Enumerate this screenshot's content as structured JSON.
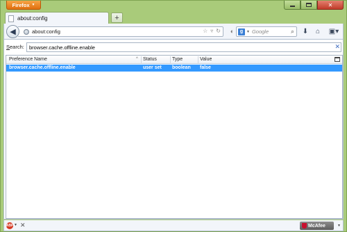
{
  "window": {
    "app_button_label": "Firefox",
    "app_button_caret": "▼",
    "accent_color": "#e0700f",
    "frame_color": "#a9cb7a"
  },
  "tabs": [
    {
      "label": "about:config",
      "icon": "page-icon"
    }
  ],
  "new_tab_label": "+",
  "navbar": {
    "back_icon": "back-arrow-icon",
    "url": "about:config",
    "search_placeholder": "Google",
    "search_engine_letter": "g"
  },
  "filter": {
    "label_pre": "",
    "label_underlined": "S",
    "label_post": "earch:",
    "value": "browser.cache.offline.enable",
    "clear_glyph": "✕"
  },
  "table": {
    "columns": [
      "Preference Name",
      "Status",
      "Type",
      "Value"
    ],
    "sort_indicator": "^",
    "rows": [
      {
        "name": "browser.cache.offline.enable",
        "status": "user set",
        "type": "boolean",
        "value": "false",
        "selected": true
      }
    ],
    "selection_color": "#3399ff"
  },
  "statusbar": {
    "addon_icon": "abp-icon",
    "addon_text": "ABP",
    "close_glyph": "✕",
    "mcafee_label": "McAfee"
  }
}
